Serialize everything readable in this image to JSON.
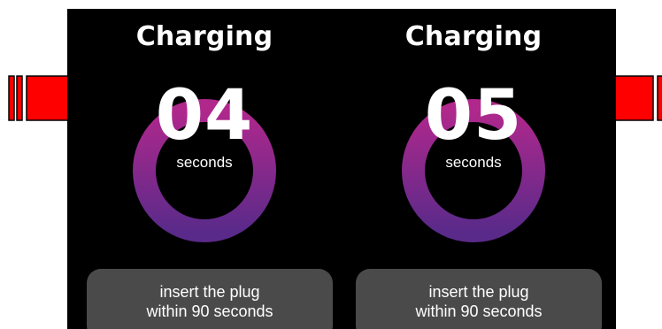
{
  "colors": {
    "screen_background": "#000000",
    "ring_top": "#b0288c",
    "ring_bottom": "#5a2a8a",
    "notice_background": "#4a4a4a",
    "arrow": "#ff0000"
  },
  "chargers": [
    {
      "title": "Charging",
      "count": "04",
      "unit": "seconds",
      "notice_line1": "insert the plug",
      "notice_line2": "within 90 seconds"
    },
    {
      "title": "Charging",
      "count": "05",
      "unit": "seconds",
      "notice_line1": "insert the plug",
      "notice_line2": "within 90 seconds"
    }
  ],
  "arrows": [
    {
      "icon": "right-arrow-icon"
    },
    {
      "icon": "left-arrow-icon"
    }
  ]
}
